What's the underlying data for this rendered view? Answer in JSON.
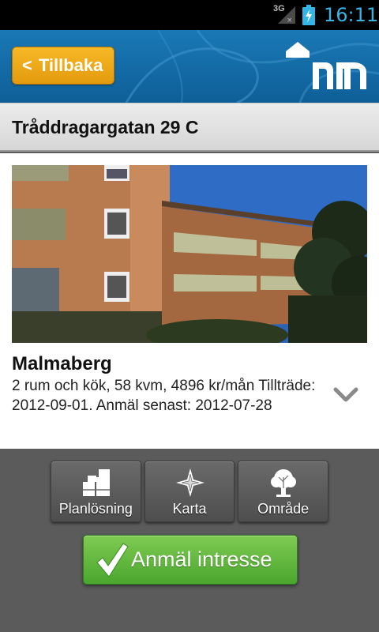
{
  "status_bar": {
    "network": "3G",
    "time": "16:11",
    "icons": [
      "signal-icon",
      "battery-charging-icon"
    ]
  },
  "header": {
    "back_label": "Tillbaka",
    "back_icon": "chevron-left-icon",
    "logo_icon": "m-house-logo"
  },
  "title": "Tråddragargatan 29 C",
  "listing": {
    "area": "Malmaberg",
    "description": "2 rum och kök, 58 kvm, 4896 kr/mån Tillträde: 2012-09-01. Anmäl senast: 2012-07-28",
    "photo": "building-photo",
    "expand_icon": "chevron-down-icon"
  },
  "actions": [
    {
      "label": "Planlösning",
      "icon": "floorplan-icon"
    },
    {
      "label": "Karta",
      "icon": "compass-icon"
    },
    {
      "label": "Område",
      "icon": "tree-icon"
    }
  ],
  "cta": {
    "label": "Anmäl intresse",
    "icon": "checkmark-icon",
    "color": "#5cb53a"
  },
  "colors": {
    "header_blue": "#1a78b5",
    "back_orange": "#eea716",
    "status_time": "#33b5e5"
  }
}
